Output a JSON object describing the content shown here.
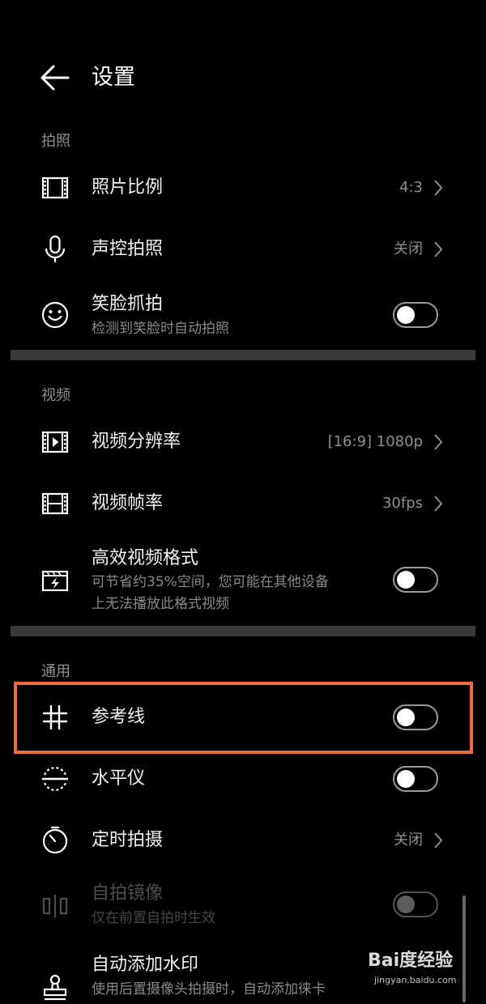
{
  "header": {
    "title": "设置"
  },
  "sections": {
    "photo": "拍照",
    "video": "视频",
    "general": "通用"
  },
  "rows": {
    "aspect": {
      "title": "照片比例",
      "value": "4:3"
    },
    "voice": {
      "title": "声控拍照",
      "value": "关闭"
    },
    "smile": {
      "title": "笑脸抓拍",
      "subtitle": "检测到笑脸时自动拍照",
      "toggle_on": false
    },
    "resolution": {
      "title": "视频分辨率",
      "value": "[16:9] 1080p"
    },
    "framerate": {
      "title": "视频帧率",
      "value": "30fps"
    },
    "efficient": {
      "title": "高效视频格式",
      "subtitle_line1": "可节省约35%空间，您可能在其他设备",
      "subtitle_line2": "上无法播放此格式视频",
      "toggle_on": false
    },
    "grid": {
      "title": "参考线",
      "toggle_on": false
    },
    "level": {
      "title": "水平仪",
      "toggle_on": false
    },
    "timer": {
      "title": "定时拍摄",
      "value": "关闭"
    },
    "mirror": {
      "title": "自拍镜像",
      "subtitle": "仅在前置自拍时生效",
      "toggle_on": false,
      "disabled": true
    },
    "watermark": {
      "title": "自动添加水印",
      "subtitle": "使用后置摄像头拍摄时，自动添加徕卡"
    }
  },
  "overlay": {
    "highlight_color": "#f26b40",
    "watermark_text": "Bai度经验",
    "watermark_url": "jingyan.baidu.com"
  },
  "icons": {
    "back": "arrow-left-icon",
    "aspect": "film-frame-icon",
    "voice": "microphone-icon",
    "smile": "smile-icon",
    "resolution": "video-play-icon",
    "framerate": "film-strip-icon",
    "efficient": "lightning-clapper-icon",
    "grid": "hash-grid-icon",
    "level": "level-icon",
    "timer": "timer-icon",
    "mirror": "mirror-icon",
    "watermark": "stamp-icon"
  }
}
